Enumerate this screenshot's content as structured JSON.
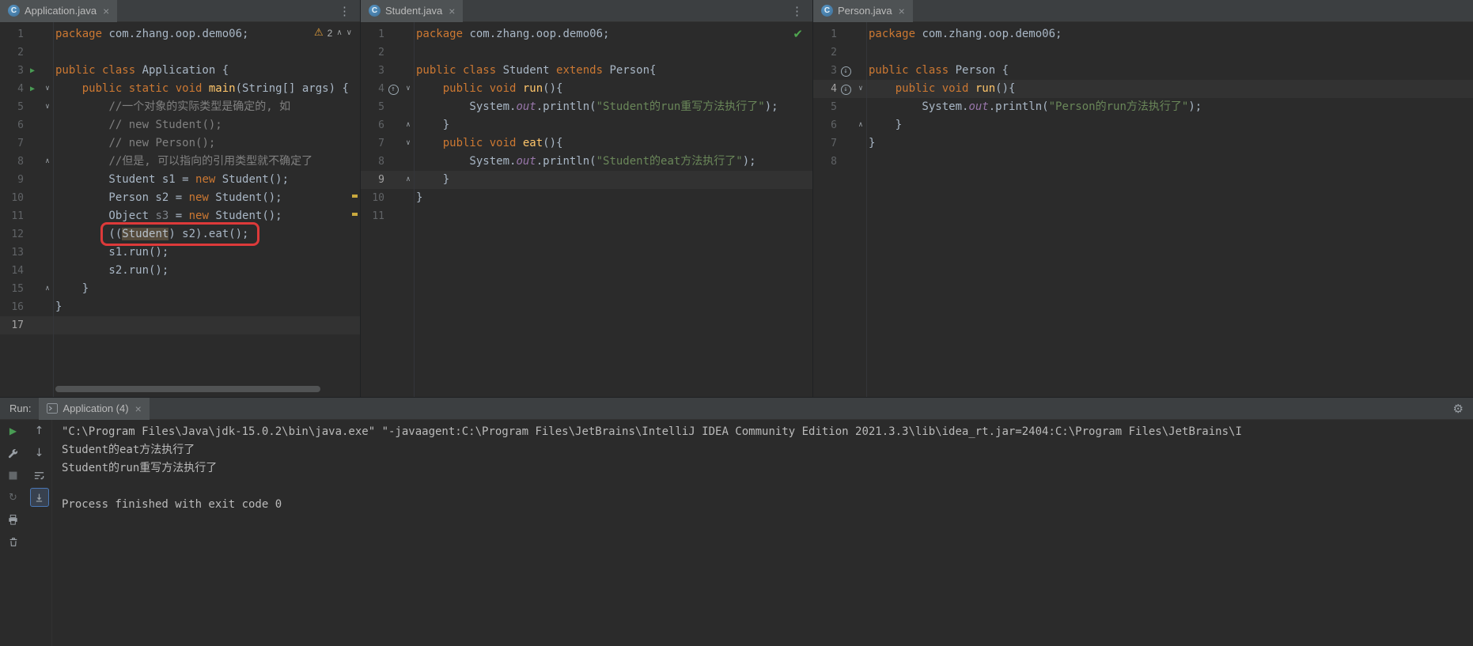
{
  "colors": {
    "background": "#2b2b2b",
    "tab_bar": "#3c3f41",
    "keyword": "#cc7832",
    "string": "#6a8759",
    "comment": "#808080",
    "method": "#ffc66b",
    "warning": "#e8a33d",
    "run_green": "#499c54",
    "check_green": "#4fa54f",
    "annotation_red": "#dd3a3a",
    "selection_bg": "#554b3c"
  },
  "panes": [
    {
      "tab_title": "Application.java",
      "inspection": {
        "warning_count": "2"
      },
      "lines": [
        {
          "n": "1",
          "tokens": [
            [
              "k",
              "package "
            ],
            [
              "d",
              "com.zhang.oop.demo06;"
            ]
          ]
        },
        {
          "n": "2",
          "tokens": []
        },
        {
          "n": "3",
          "marker": "run",
          "tokens": [
            [
              "k",
              "public class "
            ],
            [
              "d",
              "Application {"
            ]
          ]
        },
        {
          "n": "4",
          "marker": "run",
          "fold": "open",
          "tokens": [
            [
              "d",
              "    "
            ],
            [
              "k",
              "public static void "
            ],
            [
              "m",
              "main"
            ],
            [
              "d",
              "(String[] args) {"
            ]
          ]
        },
        {
          "n": "5",
          "fold": "open",
          "tokens": [
            [
              "d",
              "        "
            ],
            [
              "c",
              "//一个对象的实际类型是确定的, 如"
            ]
          ]
        },
        {
          "n": "6",
          "tokens": [
            [
              "d",
              "        "
            ],
            [
              "c",
              "// new Student();"
            ]
          ]
        },
        {
          "n": "7",
          "tokens": [
            [
              "d",
              "        "
            ],
            [
              "c",
              "// new Person();"
            ]
          ]
        },
        {
          "n": "8",
          "fold": "close",
          "tokens": [
            [
              "d",
              "        "
            ],
            [
              "c",
              "//但是, 可以指向的引用类型就不确定了"
            ]
          ]
        },
        {
          "n": "9",
          "tokens": [
            [
              "d",
              "        Student s1 = "
            ],
            [
              "k",
              "new "
            ],
            [
              "d",
              "Student();"
            ]
          ]
        },
        {
          "n": "10",
          "tokens": [
            [
              "d",
              "        Person s2 = "
            ],
            [
              "k",
              "new "
            ],
            [
              "d",
              "Student();"
            ]
          ]
        },
        {
          "n": "11",
          "tokens": [
            [
              "d",
              "        Object "
            ],
            [
              "u",
              "s3"
            ],
            [
              "d",
              " = "
            ],
            [
              "k",
              "new "
            ],
            [
              "d",
              "Student();"
            ]
          ]
        },
        {
          "n": "12",
          "tokens": [
            [
              "d",
              "        (("
            ],
            [
              "sel",
              "Student"
            ],
            [
              "d",
              ") s2).eat();"
            ]
          ]
        },
        {
          "n": "13",
          "tokens": [
            [
              "d",
              "        s1.run();"
            ]
          ]
        },
        {
          "n": "14",
          "tokens": [
            [
              "d",
              "        s2.run();"
            ]
          ]
        },
        {
          "n": "15",
          "fold": "close",
          "tokens": [
            [
              "d",
              "    }"
            ]
          ]
        },
        {
          "n": "16",
          "tokens": [
            [
              "d",
              "}"
            ]
          ]
        },
        {
          "n": "17",
          "hl": true,
          "tokens": []
        }
      ]
    },
    {
      "tab_title": "Student.java",
      "lines": [
        {
          "n": "1",
          "tokens": [
            [
              "k",
              "package "
            ],
            [
              "d",
              "com.zhang.oop.demo06;"
            ]
          ]
        },
        {
          "n": "2",
          "tokens": []
        },
        {
          "n": "3",
          "tokens": [
            [
              "k",
              "public class "
            ],
            [
              "d",
              "Student "
            ],
            [
              "k",
              "extends "
            ],
            [
              "d",
              "Person{"
            ]
          ]
        },
        {
          "n": "4",
          "marker": "override-up",
          "fold": "open",
          "tokens": [
            [
              "d",
              "    "
            ],
            [
              "k",
              "public void "
            ],
            [
              "m",
              "run"
            ],
            [
              "d",
              "(){"
            ]
          ]
        },
        {
          "n": "5",
          "tokens": [
            [
              "d",
              "        System."
            ],
            [
              "f",
              "out"
            ],
            [
              "d",
              ".println("
            ],
            [
              "s",
              "\"Student的run重写方法执行了\""
            ],
            [
              "d",
              ");"
            ]
          ]
        },
        {
          "n": "6",
          "fold": "close",
          "tokens": [
            [
              "d",
              "    }"
            ]
          ]
        },
        {
          "n": "7",
          "fold": "open",
          "tokens": [
            [
              "d",
              "    "
            ],
            [
              "k",
              "public void "
            ],
            [
              "m",
              "eat"
            ],
            [
              "d",
              "(){"
            ]
          ]
        },
        {
          "n": "8",
          "tokens": [
            [
              "d",
              "        System."
            ],
            [
              "f",
              "out"
            ],
            [
              "d",
              ".println("
            ],
            [
              "s",
              "\"Student的eat方法执行了\""
            ],
            [
              "d",
              ");"
            ]
          ]
        },
        {
          "n": "9",
          "hl": true,
          "fold": "close",
          "tokens": [
            [
              "d",
              "    }"
            ]
          ]
        },
        {
          "n": "10",
          "tokens": [
            [
              "d",
              "}"
            ]
          ]
        },
        {
          "n": "11",
          "tokens": []
        }
      ]
    },
    {
      "tab_title": "Person.java",
      "lines": [
        {
          "n": "1",
          "tokens": [
            [
              "k",
              "package "
            ],
            [
              "d",
              "com.zhang.oop.demo06;"
            ]
          ]
        },
        {
          "n": "2",
          "tokens": []
        },
        {
          "n": "3",
          "marker": "override-down",
          "tokens": [
            [
              "k",
              "public class "
            ],
            [
              "d",
              "Person {"
            ]
          ]
        },
        {
          "n": "4",
          "marker": "override-down",
          "fold": "open",
          "hl": true,
          "tokens": [
            [
              "d",
              "    "
            ],
            [
              "k",
              "public void "
            ],
            [
              "m",
              "run"
            ],
            [
              "d",
              "(){"
            ]
          ]
        },
        {
          "n": "5",
          "tokens": [
            [
              "d",
              "        System."
            ],
            [
              "f",
              "out"
            ],
            [
              "d",
              ".println("
            ],
            [
              "s",
              "\"Person的run方法执行了\""
            ],
            [
              "d",
              ");"
            ]
          ]
        },
        {
          "n": "6",
          "fold": "close",
          "tokens": [
            [
              "d",
              "    }"
            ]
          ]
        },
        {
          "n": "7",
          "tokens": [
            [
              "d",
              "}"
            ]
          ]
        },
        {
          "n": "8",
          "tokens": []
        }
      ]
    }
  ],
  "run_panel": {
    "label": "Run:",
    "tab_title": "Application (4)",
    "console_lines": [
      "\"C:\\Program Files\\Java\\jdk-15.0.2\\bin\\java.exe\" \"-javaagent:C:\\Program Files\\JetBrains\\IntelliJ IDEA Community Edition 2021.3.3\\lib\\idea_rt.jar=2404:C:\\Program Files\\JetBrains\\I",
      "Student的eat方法执行了",
      "Student的run重写方法执行了",
      "",
      "Process finished with exit code 0"
    ],
    "toolbar_icons": [
      [
        "rerun-icon",
        "up-arrow-icon"
      ],
      [
        "wrench-icon",
        "down-arrow-icon"
      ],
      [
        "stop-icon",
        "soft-wrap-icon"
      ],
      [
        "restore-icon",
        "scroll-end-icon"
      ],
      [
        "print-icon",
        null
      ],
      [
        "clear-icon",
        null
      ]
    ]
  }
}
